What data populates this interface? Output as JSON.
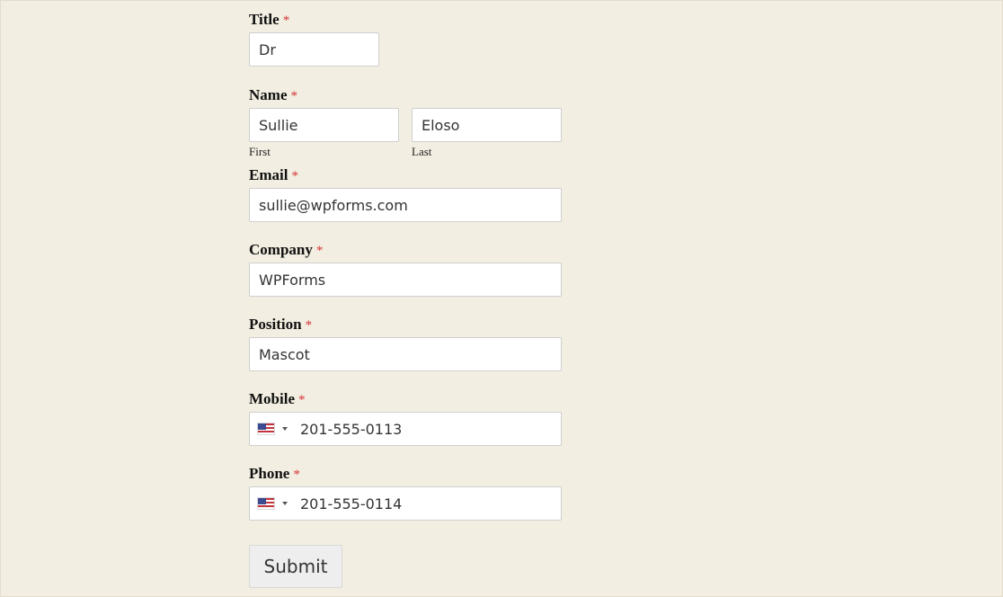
{
  "form": {
    "title": {
      "label": "Title",
      "required_mark": "*",
      "value": "Dr"
    },
    "name": {
      "label": "Name",
      "required_mark": "*",
      "first": {
        "value": "Sullie",
        "sublabel": "First"
      },
      "last": {
        "value": "Eloso",
        "sublabel": "Last"
      }
    },
    "email": {
      "label": "Email",
      "required_mark": "*",
      "value": "sullie@wpforms.com"
    },
    "company": {
      "label": "Company",
      "required_mark": "*",
      "value": "WPForms"
    },
    "position": {
      "label": "Position",
      "required_mark": "*",
      "value": "Mascot"
    },
    "mobile": {
      "label": "Mobile",
      "required_mark": "*",
      "country_flag": "us-flag-icon",
      "value": "201-555-0113"
    },
    "phone": {
      "label": "Phone",
      "required_mark": "*",
      "country_flag": "us-flag-icon",
      "value": "201-555-0114"
    },
    "submit_label": "Submit"
  },
  "colors": {
    "background": "#f2eee1",
    "required": "#d63637",
    "input_bg": "#ffffff",
    "button_bg": "#eeeeee"
  }
}
